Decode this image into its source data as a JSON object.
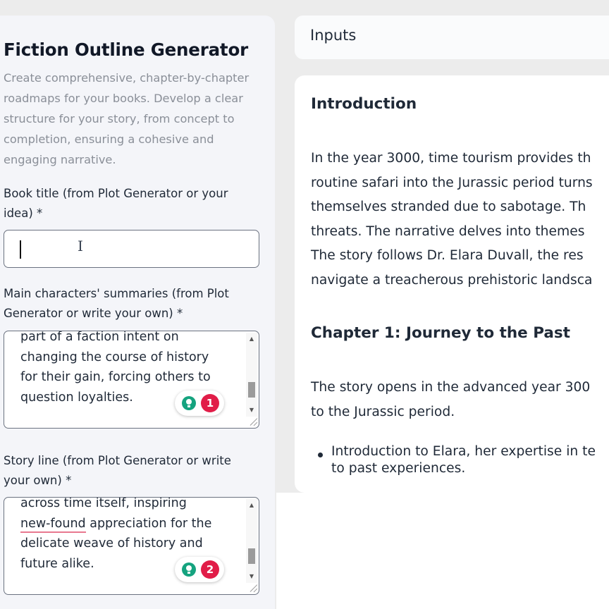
{
  "form": {
    "title": "Fiction Outline Generator",
    "description": "Create comprehensive, chapter-by-chapter roadmaps for your books. Develop a clear structure for your story, from concept to completion, ensuring a cohesive and engaging narrative.",
    "book_title": {
      "label": "Book title (from Plot Generator or your idea) *",
      "value": ""
    },
    "characters": {
      "label": "Main characters' summaries (from Plot Generator or write your own) *",
      "lines": [
        "part of a faction intent on",
        "changing the course of history",
        "for their gain, forcing others to",
        "question loyalties."
      ],
      "issue_count": "1"
    },
    "story_line": {
      "label": "Story line (from Plot Generator or write your own) *",
      "line1": "across time itself, inspiring",
      "line2_underlined": "new-found",
      "line2_rest": " appreciation for the",
      "line3": "delicate weave of history and",
      "line4": "future alike.",
      "issue_count": "2"
    }
  },
  "inputs_header": "Inputs",
  "output": {
    "heading1": "Introduction",
    "intro_lines": [
      "In the year 3000, time tourism provides th",
      "routine safari into the Jurassic period turns",
      "themselves stranded due to sabotage. Th",
      "threats. The narrative delves into themes",
      "The story follows Dr. Elara Duvall, the res",
      "navigate a treacherous prehistoric landsca"
    ],
    "heading2": "Chapter 1: Journey to the Past",
    "ch1_lines": [
      "The story opens in the advanced year 300",
      "to the Jurassic period."
    ],
    "bullet_lines": [
      "Introduction to Elara, her expertise in te",
      "to past experiences."
    ]
  },
  "colors": {
    "accent_green": "#15a37f",
    "badge_red": "#e11d48",
    "underline_pink": "#e8788f"
  }
}
